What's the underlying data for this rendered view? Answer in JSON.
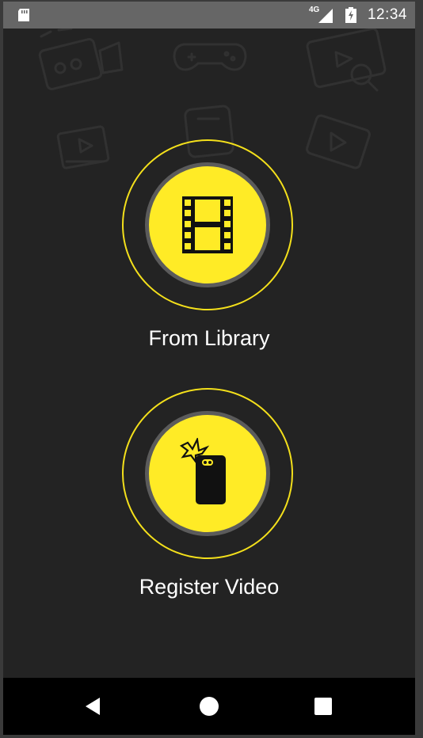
{
  "status_bar": {
    "network": "4G",
    "time": "12:34",
    "icons": [
      "sd-card-icon",
      "signal-icon",
      "battery-charging-icon"
    ]
  },
  "actions": [
    {
      "label": "From Library",
      "icon": "film-strip-icon"
    },
    {
      "label": "Register Video",
      "icon": "phone-camera-icon"
    }
  ],
  "nav_bar": {
    "icons": [
      "back-icon",
      "home-icon",
      "recents-icon"
    ]
  },
  "colors": {
    "background": "#232323",
    "accent": "#ffeb26",
    "ring": "#f4e01b",
    "status_bar": "#666666",
    "nav_bar": "#000000"
  }
}
